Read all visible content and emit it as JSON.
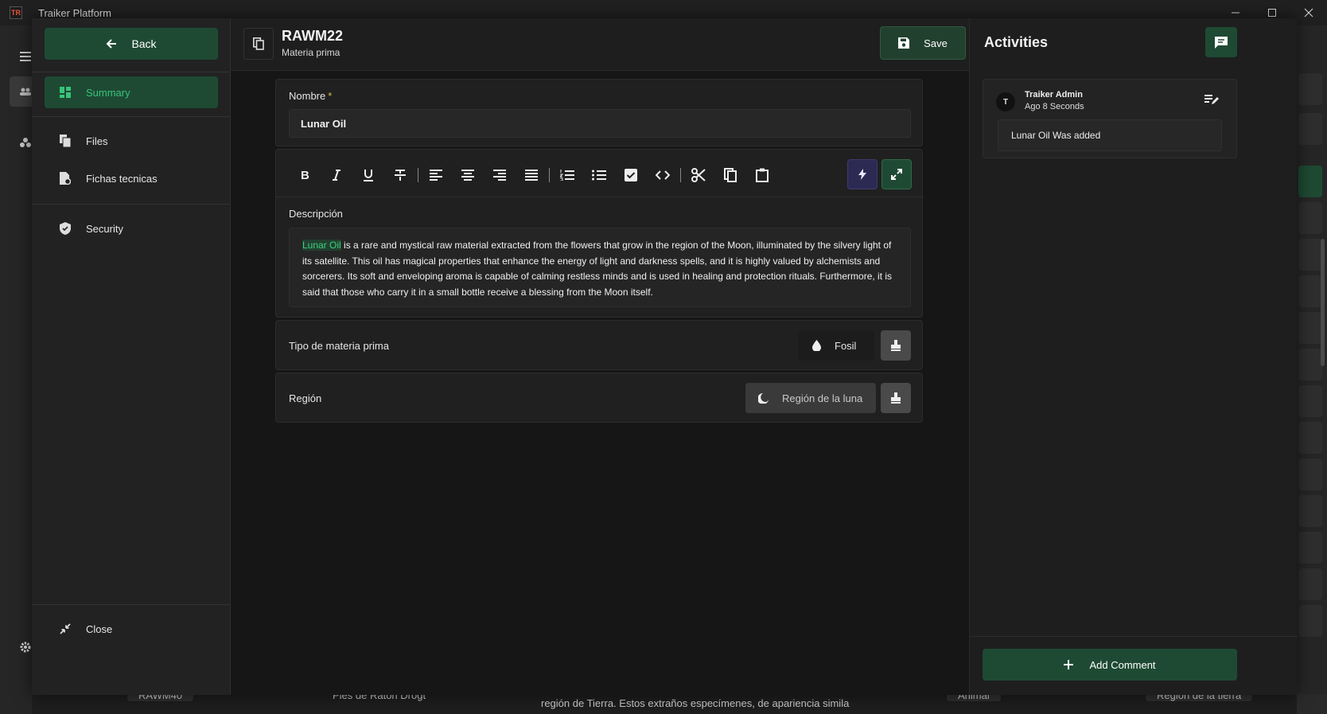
{
  "app": {
    "title": "Traiker Platform",
    "logo_text": "TR"
  },
  "nav": {
    "back_label": "Back",
    "items": [
      {
        "label": "Summary",
        "icon": "dashboard-icon",
        "active": true
      },
      {
        "label": "Files",
        "icon": "files-icon",
        "active": false
      },
      {
        "label": "Fichas tecnicas",
        "icon": "file-gear-icon",
        "active": false
      },
      {
        "label": "Security",
        "icon": "shield-icon",
        "active": false
      }
    ],
    "close_label": "Close"
  },
  "header": {
    "title": "RAWM22",
    "subtitle": "Materia prima",
    "save_label": "Save"
  },
  "form": {
    "nombre_label": "Nombre",
    "nombre_required": "*",
    "nombre_value": "Lunar Oil",
    "toolbar": [
      "bold-icon",
      "italic-icon",
      "underline-icon",
      "strikethrough-icon",
      "align-left-icon",
      "align-center-icon",
      "align-right-icon",
      "align-justify-icon",
      "numbered-list-icon",
      "bullet-list-icon",
      "checkbox-icon",
      "code-icon",
      "cut-icon",
      "copy-icon",
      "paste-icon",
      "bolt-icon",
      "expand-icon"
    ],
    "descripcion_label": "Descripción",
    "descripcion_highlight": "Lunar Oil",
    "descripcion_text": " is a rare and mystical raw material extracted from the flowers that grow in the region of the Moon, illuminated by the silvery light of its satellite. This oil has magical properties that enhance the energy of light and darkness spells, and it is highly valued by alchemists and sorcerers. Its soft and enveloping aroma is capable of calming restless minds and is used in healing and protection rituals. Furthermore, it is said that those who carry it in a small bottle receive a blessing from the Moon itself.",
    "tipo_label": "Tipo de materia prima",
    "tipo_value": "Fosil",
    "region_label": "Región",
    "region_value": "Región de la luna"
  },
  "activities": {
    "title": "Activities",
    "items": [
      {
        "avatar": "T",
        "user": "Traiker Admin",
        "time": "Ago 8 Seconds",
        "message": "Lunar Oil Was added"
      }
    ],
    "add_comment_label": "Add Comment"
  },
  "background": {
    "row_id": "RAWM40",
    "row_name": "Pies de Raton Drogt",
    "row_desc": "región de Tierra. Estos extraños especímenes, de apariencia simila",
    "row_type": "Animal",
    "row_region": "Región de la tierra"
  },
  "colors": {
    "accent": "#1e4a33",
    "accent_text": "#37c47a",
    "ai_button": "#2c2a52",
    "required": "#d7b94a"
  }
}
